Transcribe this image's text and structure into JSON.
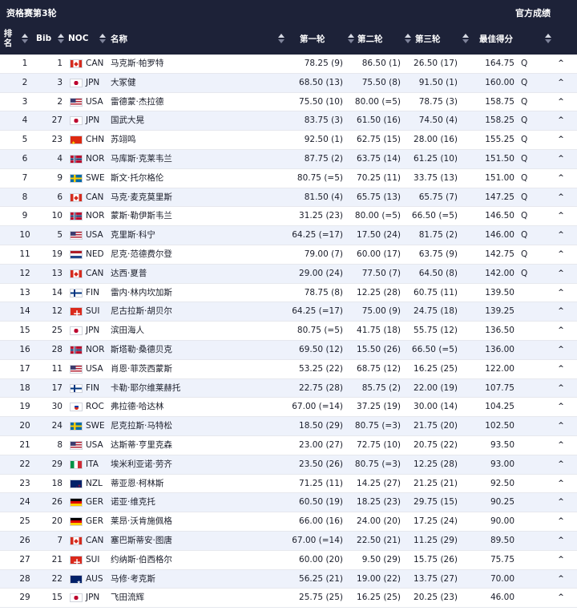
{
  "page": {
    "title": "资格赛第3轮",
    "official_label": "官方成绩"
  },
  "columns": {
    "rank": "排名",
    "bib": "Bib",
    "noc": "NOC",
    "name": "名称",
    "run1": "第一轮",
    "run2": "第二轮",
    "run3": "第三轮",
    "best": "最佳得分"
  },
  "icons": {
    "sort": "sort-icon",
    "expand": "chevron-up-icon",
    "chevron_glyph": "^"
  },
  "colors": {
    "header_bg": "#1d2238",
    "row_alt_bg": "#eef2fb",
    "text": "#1a1d2a"
  },
  "rows": [
    {
      "rank": "1",
      "bib": "1",
      "noc": "CAN",
      "name": "马克斯·帕罗特",
      "run1": "78.25 (9)",
      "run2": "86.50 (1)",
      "run3": "26.50 (17)",
      "best": "164.75",
      "q": "Q"
    },
    {
      "rank": "2",
      "bib": "3",
      "noc": "JPN",
      "name": "大冢健",
      "run1": "68.50 (13)",
      "run2": "75.50 (8)",
      "run3": "91.50 (1)",
      "best": "160.00",
      "q": "Q"
    },
    {
      "rank": "3",
      "bib": "2",
      "noc": "USA",
      "name": "雷德蒙·杰拉德",
      "run1": "75.50 (10)",
      "run2": "80.00 (=5)",
      "run3": "78.75 (3)",
      "best": "158.75",
      "q": "Q"
    },
    {
      "rank": "4",
      "bib": "27",
      "noc": "JPN",
      "name": "国武大晃",
      "run1": "83.75 (3)",
      "run2": "61.50 (16)",
      "run3": "74.50 (4)",
      "best": "158.25",
      "q": "Q"
    },
    {
      "rank": "5",
      "bib": "23",
      "noc": "CHN",
      "name": "苏翊鸣",
      "run1": "92.50 (1)",
      "run2": "62.75 (15)",
      "run3": "28.00 (16)",
      "best": "155.25",
      "q": "Q"
    },
    {
      "rank": "6",
      "bib": "4",
      "noc": "NOR",
      "name": "马库斯·克莱韦兰",
      "run1": "87.75 (2)",
      "run2": "63.75 (14)",
      "run3": "61.25 (10)",
      "best": "151.50",
      "q": "Q"
    },
    {
      "rank": "7",
      "bib": "9",
      "noc": "SWE",
      "name": "斯文·托尔格伦",
      "run1": "80.75 (=5)",
      "run2": "70.25 (11)",
      "run3": "33.75 (13)",
      "best": "151.00",
      "q": "Q"
    },
    {
      "rank": "8",
      "bib": "6",
      "noc": "CAN",
      "name": "马克·麦克莫里斯",
      "run1": "81.50 (4)",
      "run2": "65.75 (13)",
      "run3": "65.75 (7)",
      "best": "147.25",
      "q": "Q"
    },
    {
      "rank": "9",
      "bib": "10",
      "noc": "NOR",
      "name": "蒙斯·勒伊斯韦兰",
      "run1": "31.25 (23)",
      "run2": "80.00 (=5)",
      "run3": "66.50 (=5)",
      "best": "146.50",
      "q": "Q"
    },
    {
      "rank": "10",
      "bib": "5",
      "noc": "USA",
      "name": "克里斯·科宁",
      "run1": "64.25 (=17)",
      "run2": "17.50 (24)",
      "run3": "81.75 (2)",
      "best": "146.00",
      "q": "Q"
    },
    {
      "rank": "11",
      "bib": "19",
      "noc": "NED",
      "name": "尼克·范德费尔登",
      "run1": "79.00 (7)",
      "run2": "60.00 (17)",
      "run3": "63.75 (9)",
      "best": "142.75",
      "q": "Q"
    },
    {
      "rank": "12",
      "bib": "13",
      "noc": "CAN",
      "name": "达西·夏普",
      "run1": "29.00 (24)",
      "run2": "77.50 (7)",
      "run3": "64.50 (8)",
      "best": "142.00",
      "q": "Q"
    },
    {
      "rank": "13",
      "bib": "14",
      "noc": "FIN",
      "name": "雷内·林内坎加斯",
      "run1": "78.75 (8)",
      "run2": "12.25 (28)",
      "run3": "60.75 (11)",
      "best": "139.50",
      "q": ""
    },
    {
      "rank": "14",
      "bib": "12",
      "noc": "SUI",
      "name": "尼古拉斯·胡贝尔",
      "run1": "64.25 (=17)",
      "run2": "75.00 (9)",
      "run3": "24.75 (18)",
      "best": "139.25",
      "q": ""
    },
    {
      "rank": "15",
      "bib": "25",
      "noc": "JPN",
      "name": "滨田海人",
      "run1": "80.75 (=5)",
      "run2": "41.75 (18)",
      "run3": "55.75 (12)",
      "best": "136.50",
      "q": ""
    },
    {
      "rank": "16",
      "bib": "28",
      "noc": "NOR",
      "name": "斯塔勒·桑德贝克",
      "run1": "69.50 (12)",
      "run2": "15.50 (26)",
      "run3": "66.50 (=5)",
      "best": "136.00",
      "q": ""
    },
    {
      "rank": "17",
      "bib": "11",
      "noc": "USA",
      "name": "肖恩·菲茨西蒙斯",
      "run1": "53.25 (22)",
      "run2": "68.75 (12)",
      "run3": "16.25 (25)",
      "best": "122.00",
      "q": ""
    },
    {
      "rank": "18",
      "bib": "17",
      "noc": "FIN",
      "name": "卡勒·耶尔维莱赫托",
      "run1": "22.75 (28)",
      "run2": "85.75 (2)",
      "run3": "22.00 (19)",
      "best": "107.75",
      "q": ""
    },
    {
      "rank": "19",
      "bib": "30",
      "noc": "ROC",
      "name": "弗拉德·哈达林",
      "run1": "67.00 (=14)",
      "run2": "37.25 (19)",
      "run3": "30.00 (14)",
      "best": "104.25",
      "q": ""
    },
    {
      "rank": "20",
      "bib": "24",
      "noc": "SWE",
      "name": "尼克拉斯·马特松",
      "run1": "18.50 (29)",
      "run2": "80.75 (=3)",
      "run3": "21.75 (20)",
      "best": "102.50",
      "q": ""
    },
    {
      "rank": "21",
      "bib": "8",
      "noc": "USA",
      "name": "达斯蒂·亨里克森",
      "run1": "23.00 (27)",
      "run2": "72.75 (10)",
      "run3": "20.75 (22)",
      "best": "93.50",
      "q": ""
    },
    {
      "rank": "22",
      "bib": "29",
      "noc": "ITA",
      "name": "埃米利亚诺·劳齐",
      "run1": "23.50 (26)",
      "run2": "80.75 (=3)",
      "run3": "12.25 (28)",
      "best": "93.00",
      "q": ""
    },
    {
      "rank": "23",
      "bib": "18",
      "noc": "NZL",
      "name": "蒂亚恩·柯林斯",
      "run1": "71.25 (11)",
      "run2": "14.25 (27)",
      "run3": "21.25 (21)",
      "best": "92.50",
      "q": ""
    },
    {
      "rank": "24",
      "bib": "26",
      "noc": "GER",
      "name": "诺亚·维克托",
      "run1": "60.50 (19)",
      "run2": "18.25 (23)",
      "run3": "29.75 (15)",
      "best": "90.25",
      "q": ""
    },
    {
      "rank": "25",
      "bib": "20",
      "noc": "GER",
      "name": "莱昂·沃肯施佩格",
      "run1": "66.00 (16)",
      "run2": "24.00 (20)",
      "run3": "17.25 (24)",
      "best": "90.00",
      "q": ""
    },
    {
      "rank": "26",
      "bib": "7",
      "noc": "CAN",
      "name": "塞巴斯蒂安·图唐",
      "run1": "67.00 (=14)",
      "run2": "22.50 (21)",
      "run3": "11.25 (29)",
      "best": "89.50",
      "q": ""
    },
    {
      "rank": "27",
      "bib": "21",
      "noc": "SUI",
      "name": "约纳斯·伯西格尔",
      "run1": "60.00 (20)",
      "run2": "9.50 (29)",
      "run3": "15.75 (26)",
      "best": "75.75",
      "q": ""
    },
    {
      "rank": "28",
      "bib": "22",
      "noc": "AUS",
      "name": "马修·考克斯",
      "run1": "56.25 (21)",
      "run2": "19.00 (22)",
      "run3": "13.75 (27)",
      "best": "70.00",
      "q": ""
    },
    {
      "rank": "29",
      "bib": "15",
      "noc": "JPN",
      "name": "飞田流辉",
      "run1": "25.75 (25)",
      "run2": "16.25 (25)",
      "run3": "20.25 (23)",
      "best": "46.00",
      "q": ""
    }
  ]
}
